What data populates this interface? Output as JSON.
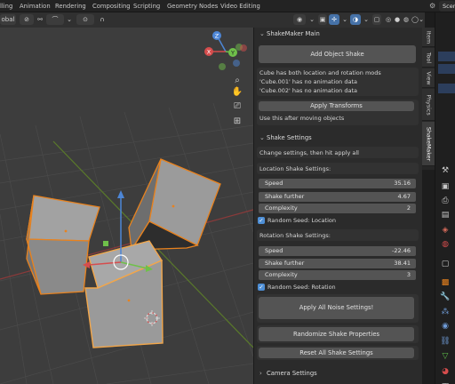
{
  "topbar": {
    "tabs": [
      "lling",
      "Animation",
      "Rendering",
      "Compositing",
      "Scripting",
      "Geometry Nodes",
      "Video Editing"
    ],
    "scene_label": "Scen"
  },
  "viewport_header": {
    "orientation_label": "obal",
    "link_icon": "link-icon",
    "gizmo_icon": "gizmo-icon",
    "overlay_icon": "overlay-icon"
  },
  "gizmo": {
    "z": "Z",
    "x": "X",
    "y": "Y"
  },
  "npanel": {
    "shakemaker_main": {
      "header": "ShakeMaker Main",
      "add_object_button": "Add Object Shake",
      "info_lines": [
        "Cube has both location and rotation mods",
        "'Cube.001' has no animation data",
        "'Cube.002' has no animation data"
      ],
      "apply_transforms_button": "Apply Transforms",
      "hint": "Use this after moving objects"
    },
    "shake_settings": {
      "header": "Shake Settings",
      "instruction": "Change settings, then hit apply all",
      "location_label": "Location Shake Settings:",
      "location_fields": [
        {
          "label": "Speed",
          "value": "35.16"
        },
        {
          "label": "Shake further",
          "value": "4.67"
        },
        {
          "label": "Complexity",
          "value": "2"
        }
      ],
      "random_seed_location": "Random Seed: Location",
      "rotation_label": "Rotation Shake Settings:",
      "rotation_fields": [
        {
          "label": "Speed",
          "value": "-22.46"
        },
        {
          "label": "Shake further",
          "value": "38.41"
        },
        {
          "label": "Complexity",
          "value": "3"
        }
      ],
      "random_seed_rotation": "Random Seed: Rotation",
      "apply_all_button": "Apply All Noise Settings!",
      "randomize_button": "Randomize Shake Properties",
      "reset_button": "Reset All Shake Settings"
    },
    "camera_settings": {
      "header": "Camera Settings"
    }
  },
  "vtabs": [
    "Item",
    "Tool",
    "View",
    "Physics",
    "ShakeMaker"
  ],
  "colors": {
    "accent": "#4672a8",
    "selection_orange": "#e8821e",
    "checkbox_blue": "#4e8fd6"
  }
}
